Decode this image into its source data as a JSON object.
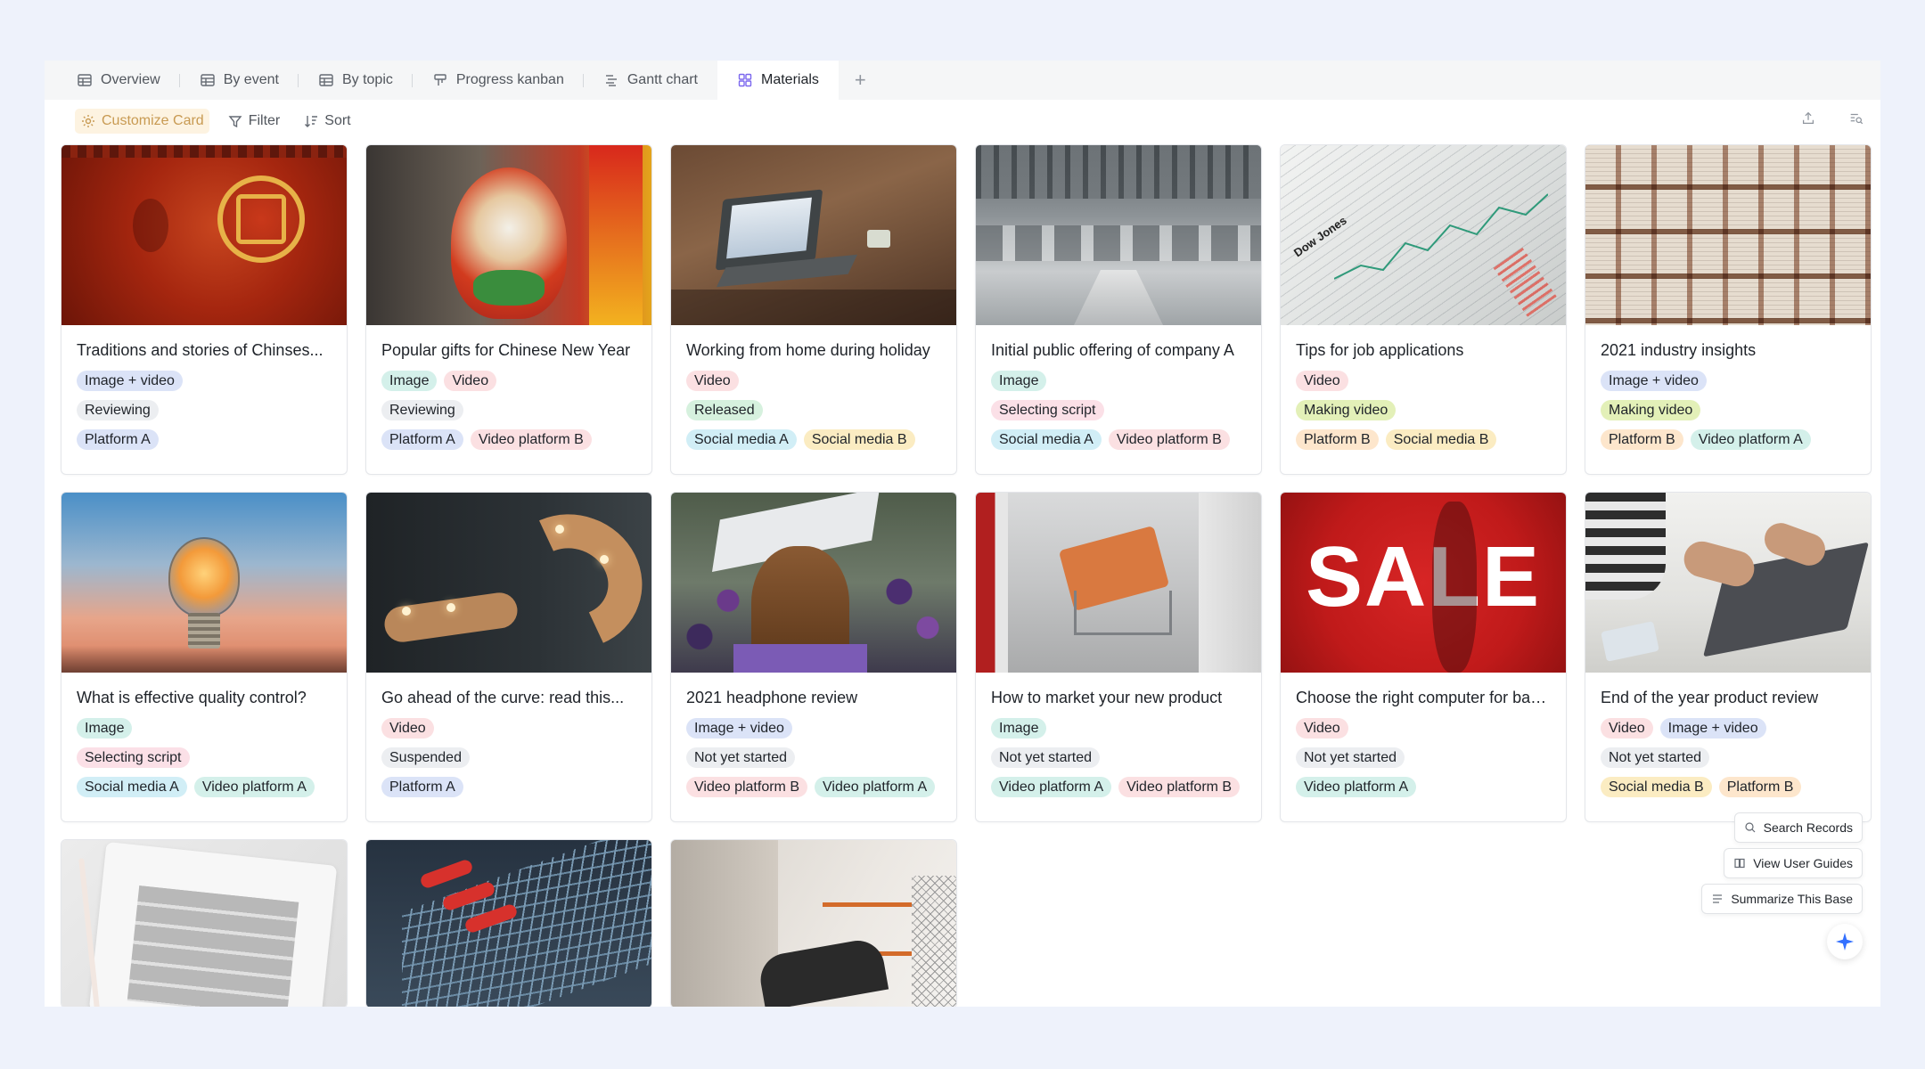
{
  "tabs": [
    {
      "label": "Overview",
      "icon": "table-icon"
    },
    {
      "label": "By event",
      "icon": "table-icon"
    },
    {
      "label": "By topic",
      "icon": "table-icon"
    },
    {
      "label": "Progress kanban",
      "icon": "kanban-icon"
    },
    {
      "label": "Gantt chart",
      "icon": "gantt-icon"
    },
    {
      "label": "Materials",
      "icon": "gallery-icon",
      "active": true
    }
  ],
  "toolbar": {
    "customize_label": "Customize Card",
    "filter_label": "Filter",
    "sort_label": "Sort"
  },
  "cards": [
    {
      "title": "Traditions and stories of Chinses...",
      "type": [
        "Image + video"
      ],
      "status": "Reviewing",
      "platforms": [
        "Platform A"
      ]
    },
    {
      "title": "Popular gifts for Chinese New Year",
      "type": [
        "Image",
        "Video"
      ],
      "status": "Reviewing",
      "platforms": [
        "Platform A",
        "Video platform B"
      ]
    },
    {
      "title": "Working from home during holiday",
      "type": [
        "Video"
      ],
      "status": "Released",
      "platforms": [
        "Social media A",
        "Social media B"
      ]
    },
    {
      "title": "Initial public offering of company A",
      "type": [
        "Image"
      ],
      "status": "Selecting script",
      "platforms": [
        "Social media A",
        "Video platform B"
      ]
    },
    {
      "title": "Tips for job applications",
      "type": [
        "Video"
      ],
      "status": "Making video",
      "platforms": [
        "Platform B",
        "Social media B"
      ]
    },
    {
      "title": "2021 industry insights",
      "type": [
        "Image + video"
      ],
      "status": "Making video",
      "platforms": [
        "Platform B",
        "Video platform A"
      ]
    },
    {
      "title": "What is effective quality control?",
      "type": [
        "Image"
      ],
      "status": "Selecting script",
      "platforms": [
        "Social media A",
        "Video platform A"
      ]
    },
    {
      "title": "Go ahead of the curve: read this...",
      "type": [
        "Video"
      ],
      "status": "Suspended",
      "platforms": [
        "Platform A"
      ]
    },
    {
      "title": "2021 headphone review",
      "type": [
        "Image + video"
      ],
      "status": "Not yet started",
      "platforms": [
        "Video platform B",
        "Video platform A"
      ]
    },
    {
      "title": "How to market your new product",
      "type": [
        "Image"
      ],
      "status": "Not yet started",
      "platforms": [
        "Video platform A",
        "Video platform B"
      ]
    },
    {
      "title": "Choose the right computer for bac...",
      "type": [
        "Video"
      ],
      "status": "Not yet started",
      "platforms": [
        "Video platform A"
      ]
    },
    {
      "title": "End of the year product review",
      "type": [
        "Video",
        "Image + video"
      ],
      "status": "Not yet started",
      "platforms": [
        "Social media B",
        "Platform B"
      ]
    }
  ],
  "image_texts": {
    "sale": "SALE",
    "dow": "Dow Jones"
  },
  "helpers": {
    "search_records": "Search Records",
    "view_user_guides": "View User Guides",
    "summarize_base": "Summarize This Base"
  },
  "tag_colors": {
    "Image + video": "#dbe3f7",
    "Image": "#d4f0ea",
    "Video": "#fbe0e2",
    "Reviewing": "#eceef1",
    "Released": "#d6f1de",
    "Selecting script": "#fbe0e7",
    "Making video": "#e3f0b8",
    "Suspended": "#eceef1",
    "Not yet started": "#eceef1",
    "Platform A": "#dbe3f7",
    "Platform B": "#fde6cc",
    "Social media A": "#d1eef6",
    "Social media B": "#fbecc2",
    "Video platform A": "#d4f0ea",
    "Video platform B": "#fbe0e2"
  }
}
